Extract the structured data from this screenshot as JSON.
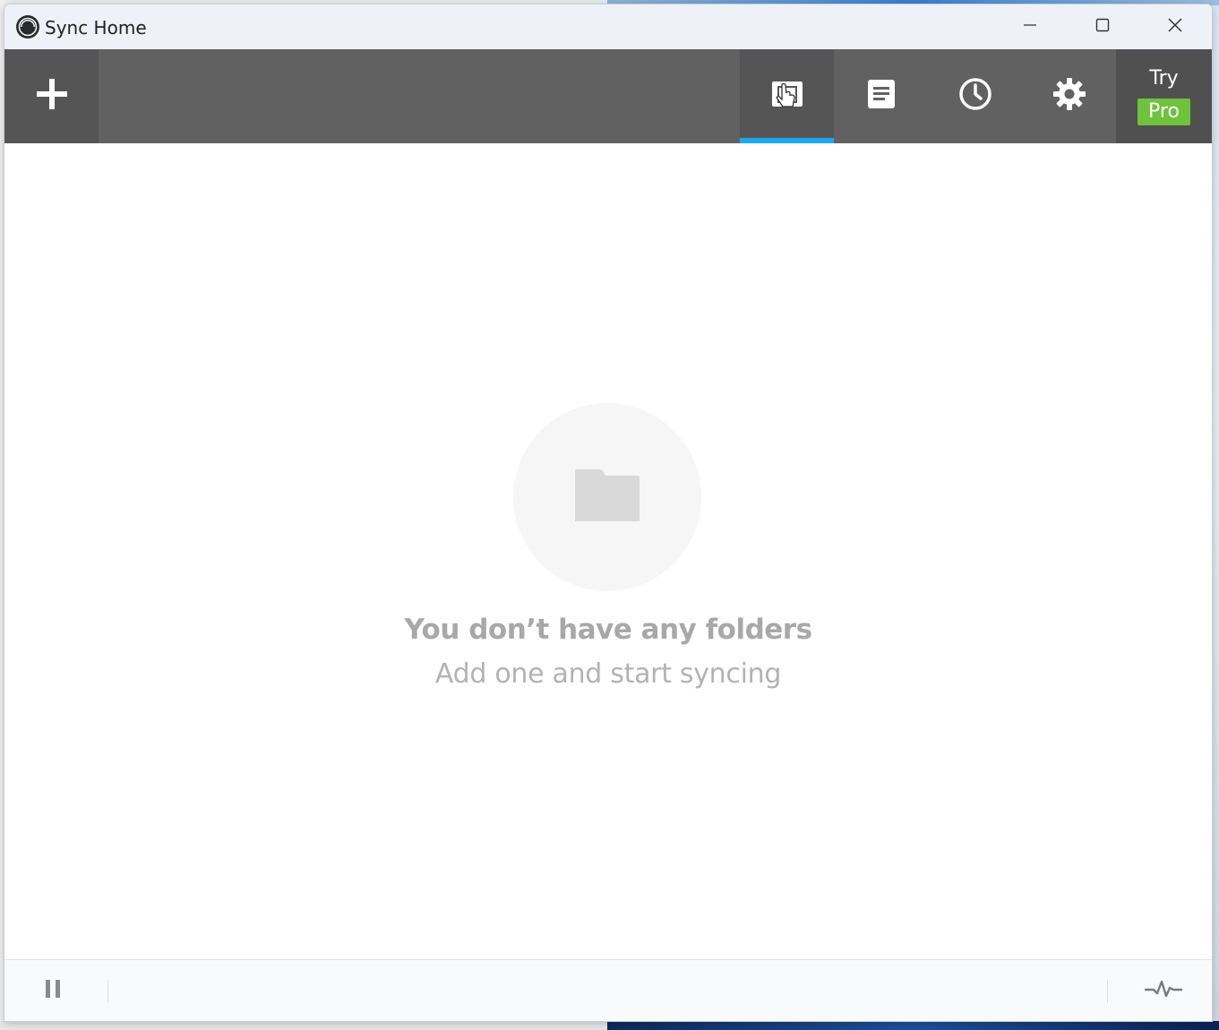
{
  "window": {
    "title": "Sync Home",
    "logo_icon": "sync-logo-icon",
    "controls": [
      "minimize-icon",
      "maximize-icon",
      "close-icon"
    ]
  },
  "toolbar": {
    "add_icon": "plus-icon",
    "tabs": [
      {
        "name": "folders",
        "icon": "folders-icon",
        "active": true
      },
      {
        "name": "transfers",
        "icon": "document-list-icon",
        "active": false
      },
      {
        "name": "history",
        "icon": "clock-icon",
        "active": false
      },
      {
        "name": "settings",
        "icon": "gear-icon",
        "active": false
      }
    ],
    "pro": {
      "try_label": "Try",
      "badge_label": "Pro"
    }
  },
  "empty_state": {
    "icon": "folder-icon",
    "title": "You don’t have any folders",
    "subtitle": "Add one and start syncing"
  },
  "statusbar": {
    "pause_icon": "pause-icon",
    "activity_icon": "activity-pulse-icon"
  },
  "colors": {
    "toolbar_bg": "#616161",
    "active_tab_indicator": "#1ba8f0",
    "pro_badge": "#6ec23c",
    "empty_text": "#a8a8a8"
  }
}
